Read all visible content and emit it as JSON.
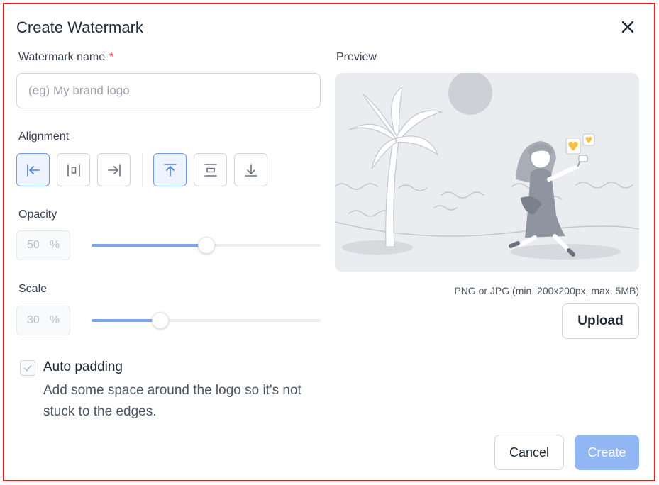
{
  "dialog": {
    "title": "Create Watermark",
    "close_icon": "close-icon"
  },
  "name_field": {
    "label": "Watermark name",
    "required_mark": "*",
    "placeholder": "(eg) My brand logo",
    "value": ""
  },
  "alignment": {
    "label": "Alignment",
    "horizontal": [
      {
        "icon": "align-left-icon",
        "active": true
      },
      {
        "icon": "align-center-horizontal-icon",
        "active": false
      },
      {
        "icon": "align-right-icon",
        "active": false
      }
    ],
    "vertical": [
      {
        "icon": "align-top-icon",
        "active": true
      },
      {
        "icon": "align-middle-icon",
        "active": false
      },
      {
        "icon": "align-bottom-icon",
        "active": false
      }
    ]
  },
  "opacity": {
    "label": "Opacity",
    "value": "50",
    "unit": "%",
    "slider_fraction": 0.5
  },
  "scale": {
    "label": "Scale",
    "value": "30",
    "unit": "%",
    "slider_fraction": 0.3
  },
  "preview": {
    "label": "Preview",
    "image_icon": "beach-selfie-illustration",
    "hint": "PNG or JPG (min. 200x200px, max. 5MB)",
    "upload_label": "Upload"
  },
  "auto_padding": {
    "checked": true,
    "label": "Auto padding",
    "description": "Add some space around the logo so it's not stuck to the edges."
  },
  "footer": {
    "cancel_label": "Cancel",
    "create_label": "Create"
  },
  "colors": {
    "accent": "#7ea5ec",
    "create_disabled": "#93b6f5",
    "required": "#ef4444",
    "frame": "#e11d1d"
  }
}
